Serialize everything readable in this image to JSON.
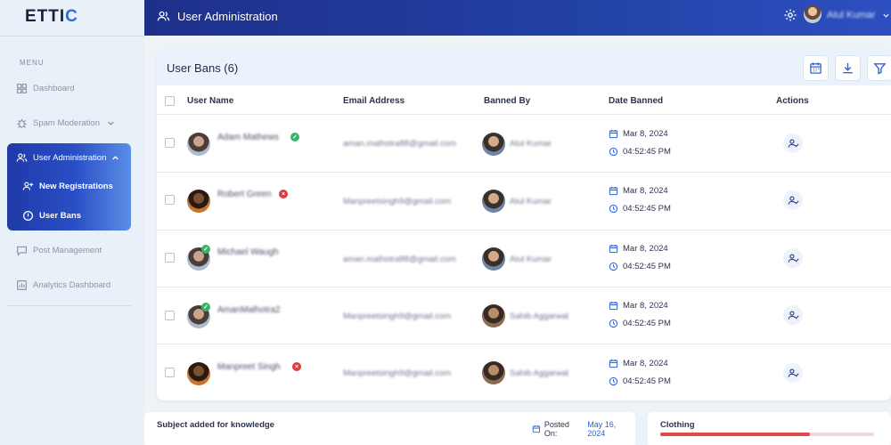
{
  "app": {
    "logo_main": "ETTI",
    "logo_accent": "C"
  },
  "sidebar": {
    "menu_title": "MENU",
    "items": [
      {
        "label": "Dashboard",
        "icon": "grid-icon"
      },
      {
        "label": "Spam Moderation",
        "icon": "bug-icon"
      },
      {
        "label": "User Administration",
        "icon": "users-icon"
      },
      {
        "label": "New Registrations",
        "icon": "user-plus-icon"
      },
      {
        "label": "User Bans",
        "icon": "alert-circle-icon"
      },
      {
        "label": "Post Management",
        "icon": "message-icon"
      },
      {
        "label": "Analytics Dashboard",
        "icon": "chart-icon"
      }
    ]
  },
  "header": {
    "title": "User Administration",
    "user_name": "Atul Kumar"
  },
  "panel": {
    "title": "User Bans (6)",
    "columns": [
      "User Name",
      "Email Address",
      "Banned By",
      "Date Banned",
      "Actions"
    ],
    "rows": [
      {
        "name": "Adam Mathews",
        "status": "ok",
        "email": "aman.malhotra88@gmail.com",
        "banned_by": "Atul Kumar",
        "date": "Mar 8, 2024",
        "time": "04:52:45 PM"
      },
      {
        "name": "Robert Green",
        "status": "bad",
        "email": "Manpreetsingh9@gmail.com",
        "banned_by": "Atul Kumar",
        "date": "Mar 8, 2024",
        "time": "04:52:45 PM"
      },
      {
        "name": "Michael Waugh",
        "status": "ok",
        "email": "aman.malhotra88@gmail.com",
        "banned_by": "Atul Kumar",
        "date": "Mar 8, 2024",
        "time": "04:52:45 PM"
      },
      {
        "name": "AmanMalhotra2",
        "status": "ok",
        "email": "Manpreetsingh9@gmail.com",
        "banned_by": "Sahib Aggarwal",
        "date": "Mar 8, 2024",
        "time": "04:52:45 PM"
      },
      {
        "name": "Manpreet Singh",
        "status": "bad",
        "email": "Manpreetsingh9@gmail.com",
        "banned_by": "Sahib Aggarwal",
        "date": "Mar 8, 2024",
        "time": "04:52:45 PM"
      }
    ]
  },
  "bottom": {
    "left_title": "Subject added for knowledge",
    "posted_label": "Posted On:",
    "posted_date": "May 16, 2024",
    "right_title": "Clothing",
    "progress": 0.7
  },
  "colors": {
    "header_start": "#1d2f8a",
    "header_end": "#2d4fc1",
    "accent_blue": "#2f63d6",
    "status_ok": "#3bb36a",
    "status_bad": "#e03a3a"
  }
}
